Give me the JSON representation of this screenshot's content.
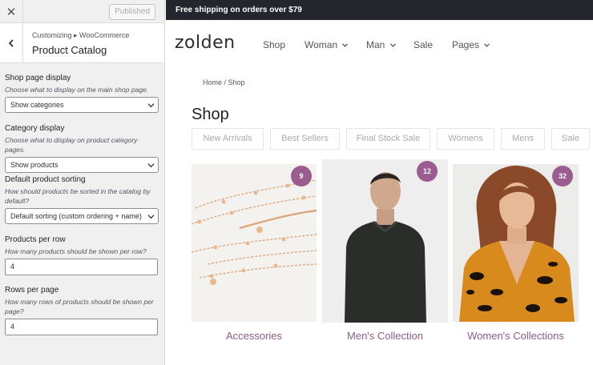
{
  "customizer": {
    "close_icon": "close-icon",
    "published_label": "Published",
    "breadcrumb": "Customizing ▸ WooCommerce",
    "title": "Product Catalog",
    "fields": [
      {
        "label": "Shop page display",
        "desc": "Choose what to display on the main shop page.",
        "value": "Show categories"
      },
      {
        "label": "Category display",
        "desc": "Choose what to display on product category pages.",
        "value": "Show products"
      },
      {
        "label": "Default product sorting",
        "desc": "How should products be sorted in the catalog by default?",
        "value": "Default sorting (custom ordering + name)"
      },
      {
        "label": "Products per row",
        "desc": "How many products should be shown per row?",
        "value": "4"
      },
      {
        "label": "Rows per page",
        "desc": "How many rows of products should be shown per page?",
        "value": "4"
      }
    ]
  },
  "site": {
    "promo": "Free shipping on orders over $79",
    "logo": "zolden",
    "nav": [
      "Shop",
      "Woman",
      "Man",
      "Sale",
      "Pages"
    ],
    "breadcrumb": "Home / Shop",
    "page_title": "Shop",
    "filters": [
      "New Arrivals",
      "Best Sellers",
      "Final Stock Sale",
      "Womens",
      "Mens",
      "Sale"
    ],
    "products": [
      {
        "title": "Accessories",
        "count": "9"
      },
      {
        "title": "Men's Collection",
        "count": "12"
      },
      {
        "title": "Women's Collections",
        "count": "32"
      }
    ],
    "colors": {
      "accent": "#9b5c8f",
      "promo_bg": "#23272d",
      "title_color": "#8f5b86"
    }
  }
}
